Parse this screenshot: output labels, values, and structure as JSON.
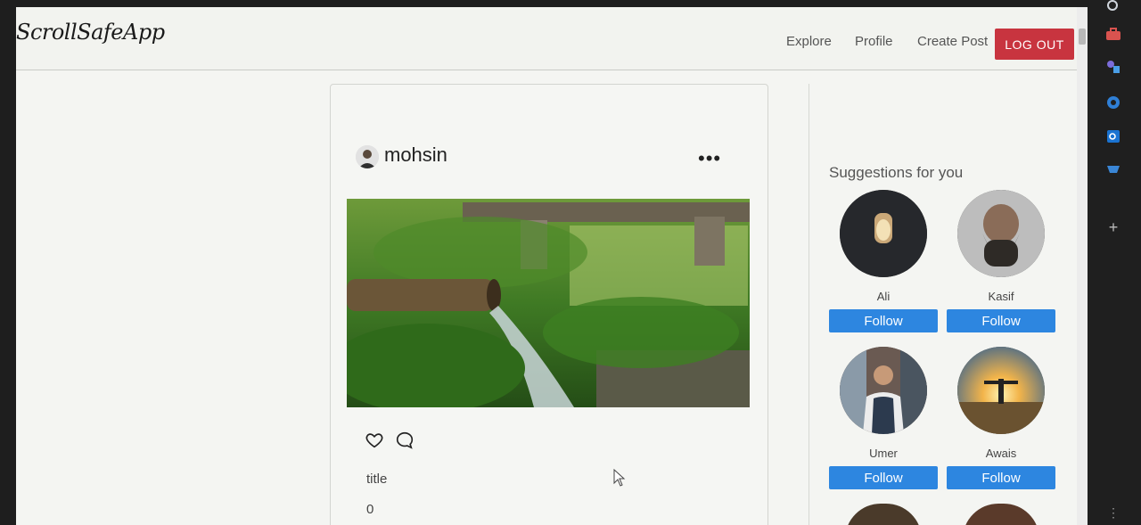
{
  "navbar": {
    "brand": "ScrollSafeApp",
    "links": [
      "Explore",
      "Profile",
      "Create Post"
    ],
    "logout_label": "LOG OUT"
  },
  "post": {
    "username": "mohsin",
    "more_label": "•••",
    "title": "title",
    "count": "0"
  },
  "suggestions": {
    "heading": "Suggestions for you",
    "users": [
      {
        "name": "Ali",
        "follow_label": "Follow"
      },
      {
        "name": "Kasif",
        "follow_label": "Follow"
      },
      {
        "name": "Umer",
        "follow_label": "Follow"
      },
      {
        "name": "Awais",
        "follow_label": "Follow"
      }
    ]
  },
  "sidebar": {
    "add_label": "+",
    "menu_label": "⋮"
  },
  "colors": {
    "logout": "#c8343f",
    "follow": "#2d86e0",
    "background": "#f4f5f2"
  }
}
